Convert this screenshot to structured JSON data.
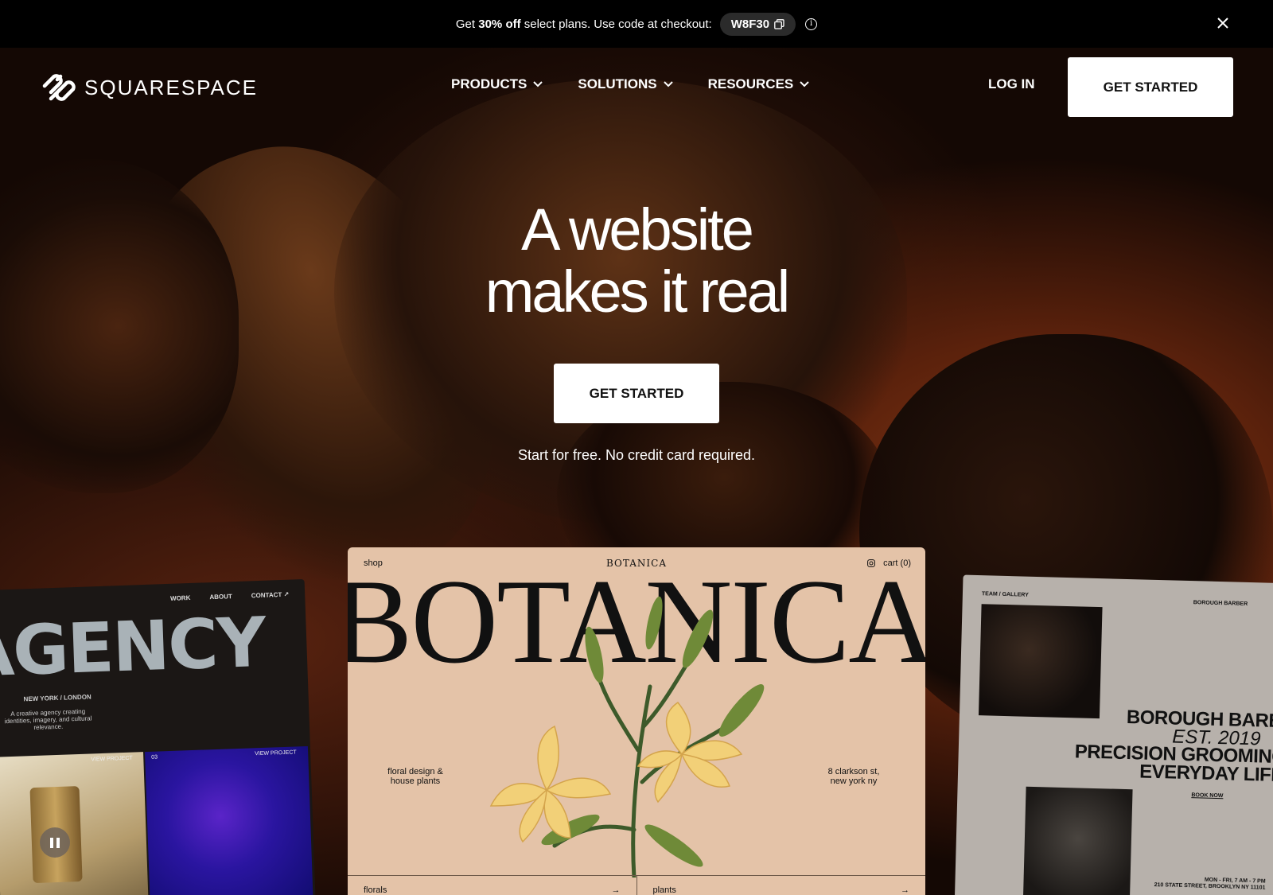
{
  "promo": {
    "prefix": "Get ",
    "discount": "30% off",
    "suffix": " select plans. Use code at checkout:",
    "code": "W8F30",
    "info_glyph": "i"
  },
  "nav": {
    "logo_text": "SQUARESPACE",
    "menu": [
      "PRODUCTS",
      "SOLUTIONS",
      "RESOURCES"
    ],
    "login": "LOG IN",
    "get_started": "GET STARTED"
  },
  "hero": {
    "headline_line1": "A website",
    "headline_line2": "makes it real",
    "cta": "GET STARTED",
    "subtext": "Start for free. No credit card required."
  },
  "agency_card": {
    "links": [
      "WORK",
      "ABOUT",
      "CONTACT ↗"
    ],
    "title": "AGENCY",
    "location": "NEW YORK / LONDON",
    "description": "A creative agency creating identities, imagery, and cultural relevance.",
    "view_project_1": "VIEW PROJECT",
    "number": "03",
    "view_project_2": "VIEW PROJECT"
  },
  "botanica_card": {
    "shop": "shop",
    "brand": "BOTANICA",
    "cart": "cart (0)",
    "giant_title": "BOTANICA",
    "left_text": "floral design & house plants",
    "right_text": "8 clarkson st, new york ny",
    "bar_left": "florals",
    "bar_right": "plants",
    "arrow": "→"
  },
  "barber_card": {
    "nav": "TEAM  /  GALLERY",
    "brand": "BOROUGH BARBER",
    "line1": "BOROUGH BARB",
    "line2": "EST. 2019",
    "line3": "PRECISION GROOMING",
    "line4": "EVERYDAY LIFE",
    "book": "BOOK NOW",
    "hours": "MON - FRI, 7 AM - 7 PM",
    "address": "210 STATE STREET, BROOKLYN NY 11101"
  },
  "colors": {
    "accent_button_bg": "#ffffff",
    "promo_bg": "#000000",
    "botanica_bg": "#e4c3a8",
    "hero_glow": "#8a3a14"
  }
}
